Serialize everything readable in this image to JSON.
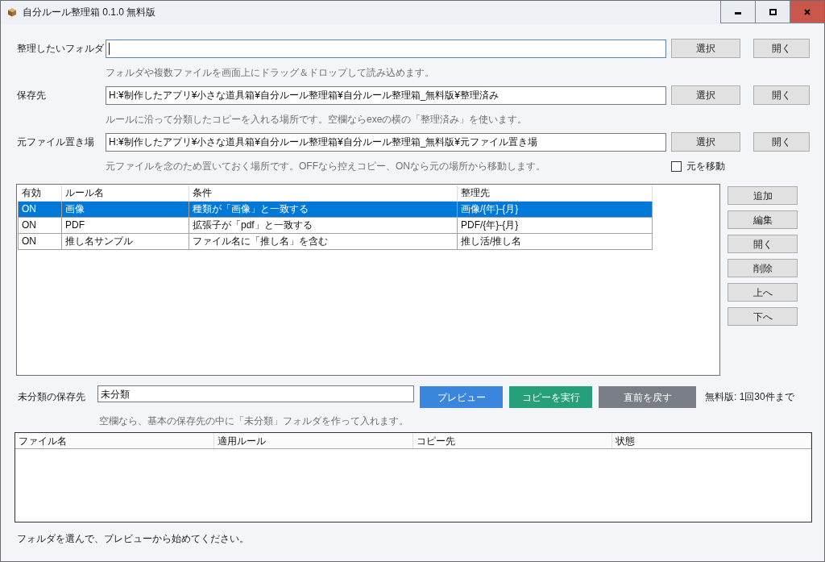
{
  "window": {
    "title": "自分ルール整理箱 0.1.0 無料版"
  },
  "paths": [
    {
      "label": "整理したいフォルダ",
      "focused": true,
      "buttons": [
        "選択",
        "開く"
      ],
      "hint": "フォルダや複数ファイルを画面上にドラッグ＆ドロップして読み込めます。"
    },
    {
      "label": "保存先",
      "focused": false,
      "value": "H:¥制作したアプリ¥小さな道具箱¥自分ルール整理箱¥自分ルール整理箱_無料版¥整理済み",
      "buttons": [
        "選択",
        "開く"
      ],
      "hint": "ルールに沿って分類したコピーを入れる場所です。空欄ならexeの横の「整理済み」を使います。"
    },
    {
      "label": "元ファイル置き場",
      "focused": false,
      "value": "H:¥制作したアプリ¥小さな道具箱¥自分ルール整理箱¥自分ルール整理箱_無料版¥元ファイル置き場",
      "buttons": [
        "選択",
        "開く"
      ],
      "hint": "元ファイルを念のため置いておく場所です。OFFなら控えコピー、ONなら元の場所から移動します。",
      "option": {
        "label": "元を移動",
        "checked": false
      }
    }
  ],
  "rules": {
    "columns": [
      "有効",
      "ルール名",
      "条件",
      "整理先"
    ],
    "rows": [
      {
        "cells": [
          "ON",
          "画像",
          "種類が「画像」と一致する",
          "画像/{年}-{月}"
        ],
        "selected": true
      },
      {
        "cells": [
          "ON",
          "PDF",
          "拡張子が「pdf」と一致する",
          "PDF/{年}-{月}"
        ],
        "selected": false
      },
      {
        "cells": [
          "ON",
          "推し名サンプル",
          "ファイル名に「推し名」を含む",
          "推し活/推し名"
        ],
        "selected": false
      }
    ],
    "buttons": [
      "追加",
      "編集",
      "開く",
      "削除",
      "上へ",
      "下へ"
    ]
  },
  "unclassified": {
    "label": "未分類の保存先",
    "value": "未分類",
    "hint": "空欄なら、基本の保存先の中に「未分類」フォルダを作って入れます。"
  },
  "actions": [
    {
      "label": "プレビュー",
      "kind": "primary"
    },
    {
      "label": "コピーを実行",
      "kind": "success"
    },
    {
      "label": "直前を戻す",
      "kind": "neutral"
    }
  ],
  "limit_note": "無料版: 1回30件まで",
  "results": {
    "columns": [
      "ファイル名",
      "適用ルール",
      "コピー先",
      "状態"
    ]
  },
  "status_bar": "フォルダを選んで、プレビューから始めてください。"
}
